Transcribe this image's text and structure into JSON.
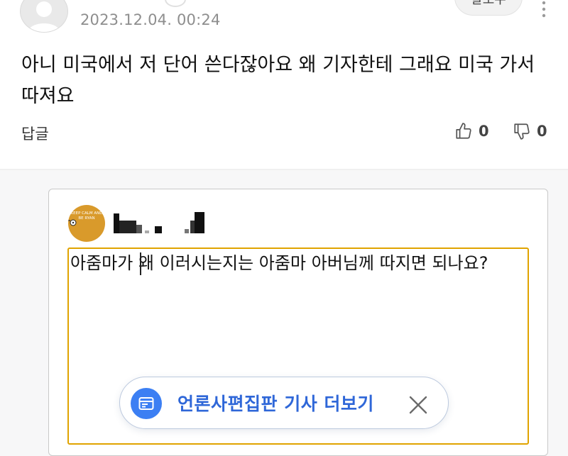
{
  "comment": {
    "timestamp": "2023.12.04. 00:24",
    "body": "아니 미국에서 저 단어 쓴다잖아요 왜 기자한테 그래요 미국 가서 따져요",
    "follow_label": "팔로우",
    "reply_label": "답글",
    "like_count": "0",
    "dislike_count": "0"
  },
  "reply_compose": {
    "avatar_text": "KEEP CALM AND BE RYAN",
    "text": "아줌마가 왜 이러시는지는 아줌마 아버님께 따지면 되나요?"
  },
  "banner": {
    "label": "언론사편집판 기사 더보기"
  },
  "icons": {
    "like": "thumbs-up-icon",
    "dislike": "thumbs-down-icon",
    "news": "news-card-icon",
    "close": "close-icon",
    "more": "more-vertical-icon"
  },
  "colors": {
    "accent_blue": "#2f67d8",
    "focus_border": "#e0a300"
  }
}
